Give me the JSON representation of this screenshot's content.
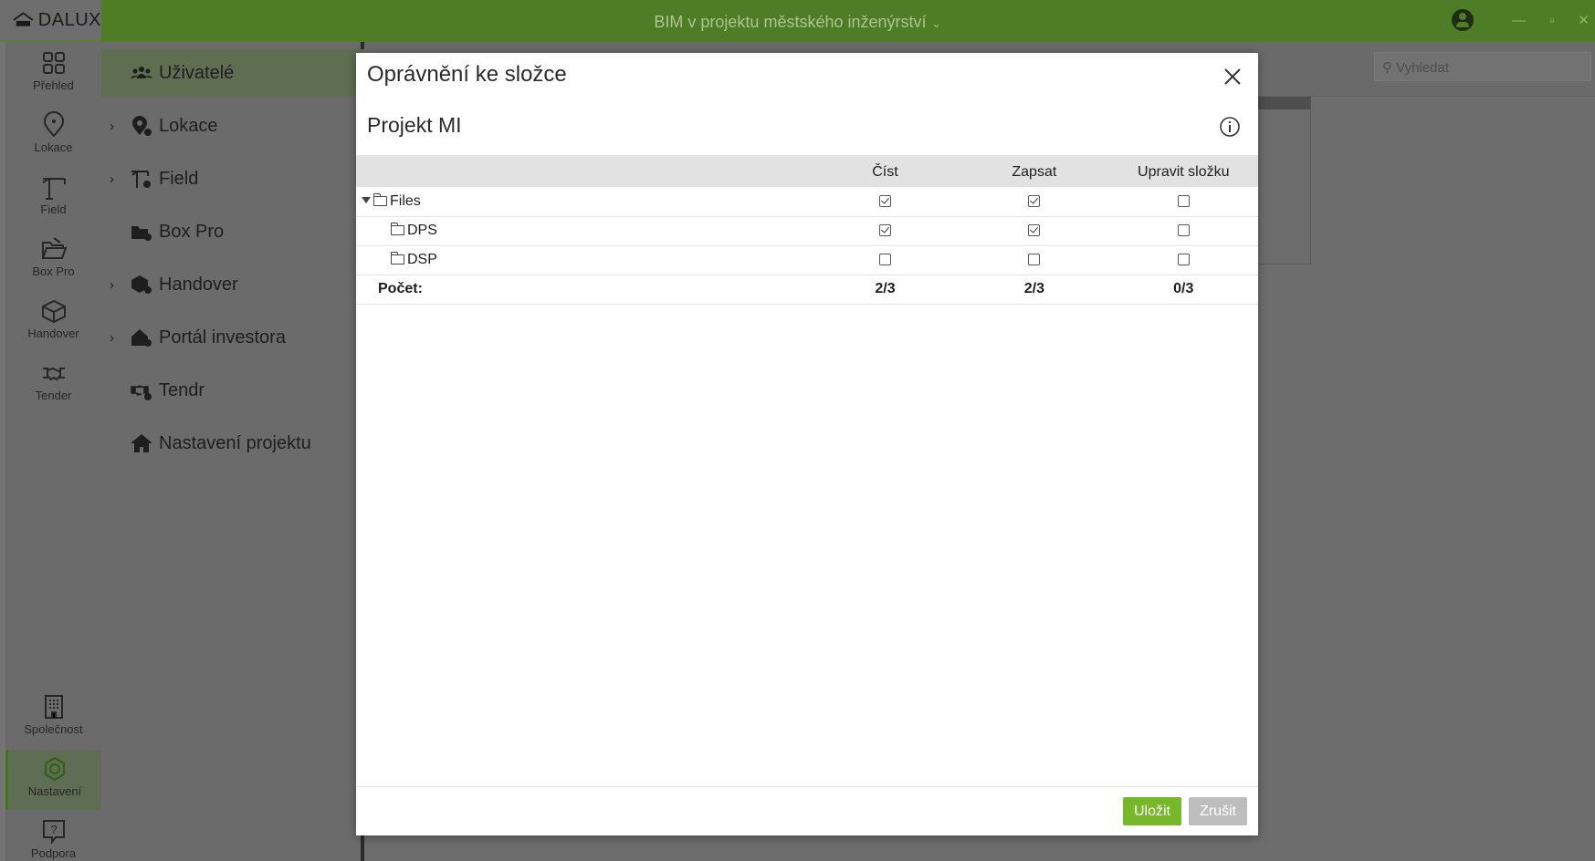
{
  "app": {
    "logo_text": "DALUX",
    "window_title": "BIM v projektu městského inženýrství"
  },
  "rail": {
    "items": [
      {
        "label": "Přehled",
        "icon": "grid-icon"
      },
      {
        "label": "Lokace",
        "icon": "location-pin-icon"
      },
      {
        "label": "Field",
        "icon": "crane-icon"
      },
      {
        "label": "Box Pro",
        "icon": "folder-open-icon"
      },
      {
        "label": "Handover",
        "icon": "box-icon"
      },
      {
        "label": "Tender",
        "icon": "handshake-icon"
      },
      {
        "label": "Společnost",
        "icon": "building-icon"
      },
      {
        "label": "Nastavení",
        "icon": "gear-icon"
      },
      {
        "label": "Podpora",
        "icon": "help-icon"
      }
    ]
  },
  "menu": {
    "items": [
      {
        "label": "Uživatelé",
        "expandable": false,
        "active": true
      },
      {
        "label": "Lokace",
        "expandable": true
      },
      {
        "label": "Field",
        "expandable": true
      },
      {
        "label": "Box Pro",
        "expandable": false
      },
      {
        "label": "Handover",
        "expandable": true
      },
      {
        "label": "Portál investora",
        "expandable": true
      },
      {
        "label": "Tendr",
        "expandable": false
      },
      {
        "label": "Nastavení projektu",
        "expandable": false
      }
    ]
  },
  "background": {
    "search_placeholder": "Vyhledat"
  },
  "modal": {
    "title": "Oprávnění ke složce",
    "subtitle": "Projekt MI",
    "columns": [
      "Číst",
      "Zapsat",
      "Upravit složku"
    ],
    "rows": [
      {
        "name": "Files",
        "expanded": true,
        "level": 0,
        "read": true,
        "write": true,
        "edit": false
      },
      {
        "name": "DPS",
        "level": 1,
        "read": true,
        "write": true,
        "edit": false
      },
      {
        "name": "DSP",
        "level": 1,
        "read": false,
        "write": false,
        "edit": false
      }
    ],
    "totals": {
      "label": "Počet:",
      "read": "2/3",
      "write": "2/3",
      "edit": "0/3"
    },
    "save_label": "Uložit",
    "cancel_label": "Zrušit"
  },
  "colors": {
    "brand_green": "#76b82a",
    "topbar_green": "#4f7d27"
  }
}
